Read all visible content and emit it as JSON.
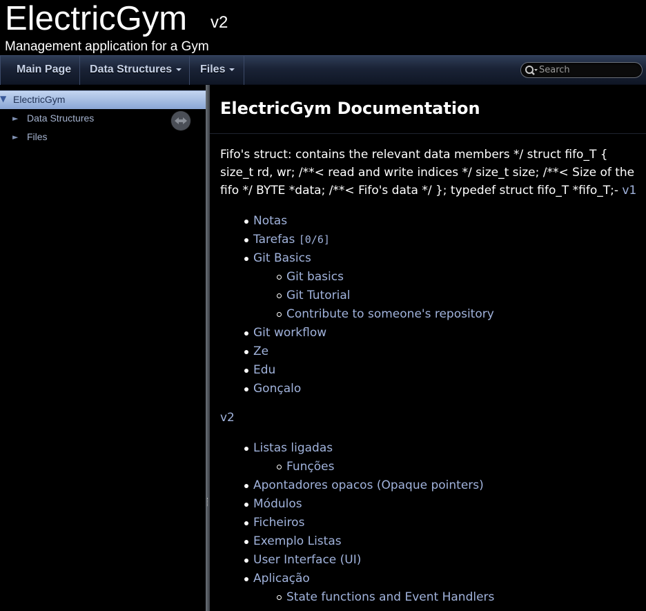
{
  "title": {
    "project_name": "ElectricGym",
    "project_number": "v2",
    "project_brief": "Management application for a Gym"
  },
  "navbar": {
    "tabs": [
      {
        "label": "Main Page"
      },
      {
        "label": "Data Structures"
      },
      {
        "label": "Files"
      }
    ],
    "search": {
      "placeholder": "Search",
      "value": ""
    }
  },
  "sidebar": {
    "root": {
      "label": "ElectricGym",
      "expanded": true,
      "selected": true
    },
    "items": [
      {
        "label": "Data Structures"
      },
      {
        "label": "Files"
      }
    ],
    "sync_icon": "sync-arrows-icon"
  },
  "content": {
    "page_title": "ElectricGym Documentation",
    "intro_text": "Fifo's struct: contains the relevant data members */ struct fifo_T { size_t rd, wr; /**< read and write indices */ size_t size; /**< Size of the fifo */ BYTE *data; /**< Fifo's data */ }; typedef struct fifo_T *fifo_T;-",
    "intro_link": "v1",
    "list1": {
      "notas": "Notas",
      "tarefas": "Tarefas",
      "tarefas_counter": "[0/6]",
      "git_basics": "Git Basics",
      "git_basics_sub": [
        "Git basics",
        "Git Tutorial",
        "Contribute to someone's repository"
      ],
      "git_workflow": "Git workflow",
      "ze": "Ze",
      "edu": "Edu",
      "goncalo": "Gonçalo"
    },
    "v2_heading": "v2",
    "list2": {
      "listas_ligadas": "Listas ligadas",
      "funcoes": "Funções",
      "apontadores": "Apontadores opacos (Opaque pointers)",
      "modulos": "Módulos",
      "ficheiros": "Ficheiros",
      "exemplo_listas": "Exemplo Listas",
      "user_interface": "User Interface (UI)",
      "aplicacao": "Aplicação",
      "state_functions": "State functions and Event Handlers"
    }
  },
  "colors": {
    "background": "#000000",
    "link": "#a1b3dc",
    "navbar_top": "#2f3d57",
    "navbar_bottom": "#0f1625",
    "sidebar_selected": "#b0c4e8"
  }
}
